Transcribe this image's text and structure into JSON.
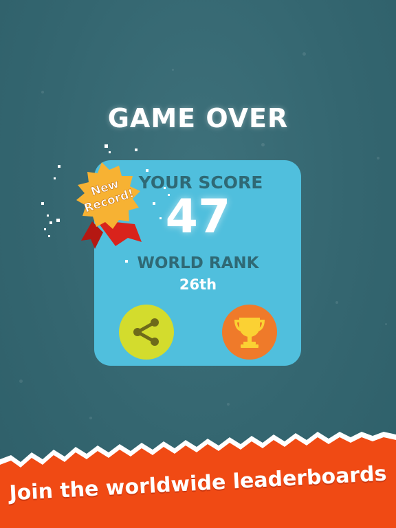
{
  "title": "GAME OVER",
  "score": {
    "label": "YOUR SCORE",
    "value": "47"
  },
  "rank": {
    "label": "WORLD RANK",
    "value": "26th"
  },
  "badge": {
    "line1": "New",
    "line2": "Record!"
  },
  "buttons": {
    "share_icon": "share-icon",
    "leaderboard_icon": "trophy-icon"
  },
  "banner": {
    "text": "Join the worldwide leaderboards"
  },
  "colors": {
    "background": "#346670",
    "card": "#50bfdd",
    "label_text": "#2f6975",
    "share_button": "#d3dc2d",
    "trophy_button": "#ef7a2a",
    "badge": "#f7b233",
    "ribbon": "#d9231c",
    "banner": "#f04a14"
  }
}
